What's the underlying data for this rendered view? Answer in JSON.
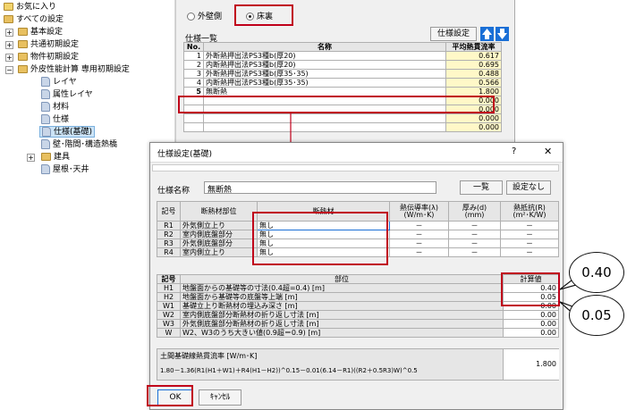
{
  "tree": {
    "items": [
      {
        "label": "お気に入り",
        "level": 0
      },
      {
        "label": "すべての設定",
        "level": 0
      },
      {
        "label": "基本設定",
        "level": 1
      },
      {
        "label": "共通初期設定",
        "level": 1
      },
      {
        "label": "物件初期設定",
        "level": 1
      },
      {
        "label": "外皮性能計算 専用初期設定",
        "level": 1
      },
      {
        "label": "レイヤ",
        "level": 2
      },
      {
        "label": "属性レイヤ",
        "level": 2
      },
      {
        "label": "材料",
        "level": 2
      },
      {
        "label": "仕様",
        "level": 2
      },
      {
        "label": "仕様(基礎)",
        "level": 2
      },
      {
        "label": "壁･階間･構造熱橋",
        "level": 2
      },
      {
        "label": "建具",
        "level": 2
      },
      {
        "label": "屋根･天井",
        "level": 2
      }
    ]
  },
  "main": {
    "radio_outer_wall": "外壁側",
    "radio_floor_back": "床裏",
    "list_title": "仕様一覧",
    "settings_button": "仕様設定",
    "columns": {
      "no": "No.",
      "name": "名称",
      "value": "平均熱貫流率"
    },
    "rows": [
      {
        "no": "1",
        "name": "外断熱押出法PS3種b(厚20)",
        "value": "0.617"
      },
      {
        "no": "2",
        "name": "内断熱押出法PS3種b(厚20)",
        "value": "0.695"
      },
      {
        "no": "3",
        "name": "外断熱押出法PS3種b(厚35･35)",
        "value": "0.488"
      },
      {
        "no": "4",
        "name": "内断熱押出法PS3種b(厚35･35)",
        "value": "0.566"
      },
      {
        "no": "5",
        "name": "無断熱",
        "value": "1.800"
      },
      {
        "no": "",
        "name": "",
        "value": "0.000"
      },
      {
        "no": "",
        "name": "",
        "value": "0.000"
      },
      {
        "no": "",
        "name": "",
        "value": "0.000"
      },
      {
        "no": "",
        "name": "",
        "value": "0.000"
      }
    ]
  },
  "dialog": {
    "title": "仕様設定(基礎)",
    "help": "?",
    "close": "✕",
    "name_label": "仕様名称",
    "name_value": "無断熱",
    "list_button": "一覧",
    "none_button": "設定なし",
    "t1_headers": {
      "code": "記号",
      "part": "断熱材部位",
      "material": "断熱材",
      "conductivity": "熱伝導率(λ)",
      "conductivity_unit": "(W/m･K)",
      "thickness": "厚み(d)",
      "thickness_unit": "(mm)",
      "resistance": "熱抵抗(R)",
      "resistance_unit": "(m²･K/W)"
    },
    "t1_rows": [
      {
        "code": "R1",
        "part": "外気側立上り",
        "material": "無し",
        "c": "－",
        "t": "－",
        "r": "－"
      },
      {
        "code": "R2",
        "part": "室内側底盤部分",
        "material": "無し",
        "c": "－",
        "t": "－",
        "r": "－"
      },
      {
        "code": "R3",
        "part": "外気側底盤部分",
        "material": "無し",
        "c": "－",
        "t": "－",
        "r": "－"
      },
      {
        "code": "R4",
        "part": "室内側立上り",
        "material": "無し",
        "c": "－",
        "t": "－",
        "r": "－"
      }
    ],
    "t2_headers": {
      "code": "記号",
      "part": "部位",
      "calc": "計算値"
    },
    "t2_rows": [
      {
        "code": "H1",
        "part": "地盤面からの基礎等の寸法(0.4超=0.4) [m]",
        "value": "0.40"
      },
      {
        "code": "H2",
        "part": "地盤面から基礎等の底盤等上端 [m]",
        "value": "0.05"
      },
      {
        "code": "W1",
        "part": "基礎立上り断熱材の埋込み深さ [m]",
        "value": "0.00"
      },
      {
        "code": "W2",
        "part": "室内側底盤部分断熱材の折り返し寸法 [m]",
        "value": "0.00"
      },
      {
        "code": "W3",
        "part": "外気側底盤部分断熱材の折り返し寸法 [m]",
        "value": "0.00"
      },
      {
        "code": "W",
        "part": "W2、W3のうち大きい値(0.9超＝0.9) [m]",
        "value": "0.00"
      }
    ],
    "formula_title": "土間基礎線熱貫流率 [W/m･K]",
    "formula": "1.80－1.36(R1(H1＋W1)＋R4(H1－H2))^0.15－0.01(6.14－R1)((R2＋0.5R3)W)^0.5",
    "formula_value": "1.800",
    "ok": "OK",
    "cancel": "ｷｬﾝｾﾙ"
  },
  "callouts": {
    "top": "0.40",
    "bottom": "0.05"
  },
  "colors": {
    "highlight": "#c0001a",
    "selection": "#cce4f7",
    "arrow_blue": "#1a6fd6"
  }
}
